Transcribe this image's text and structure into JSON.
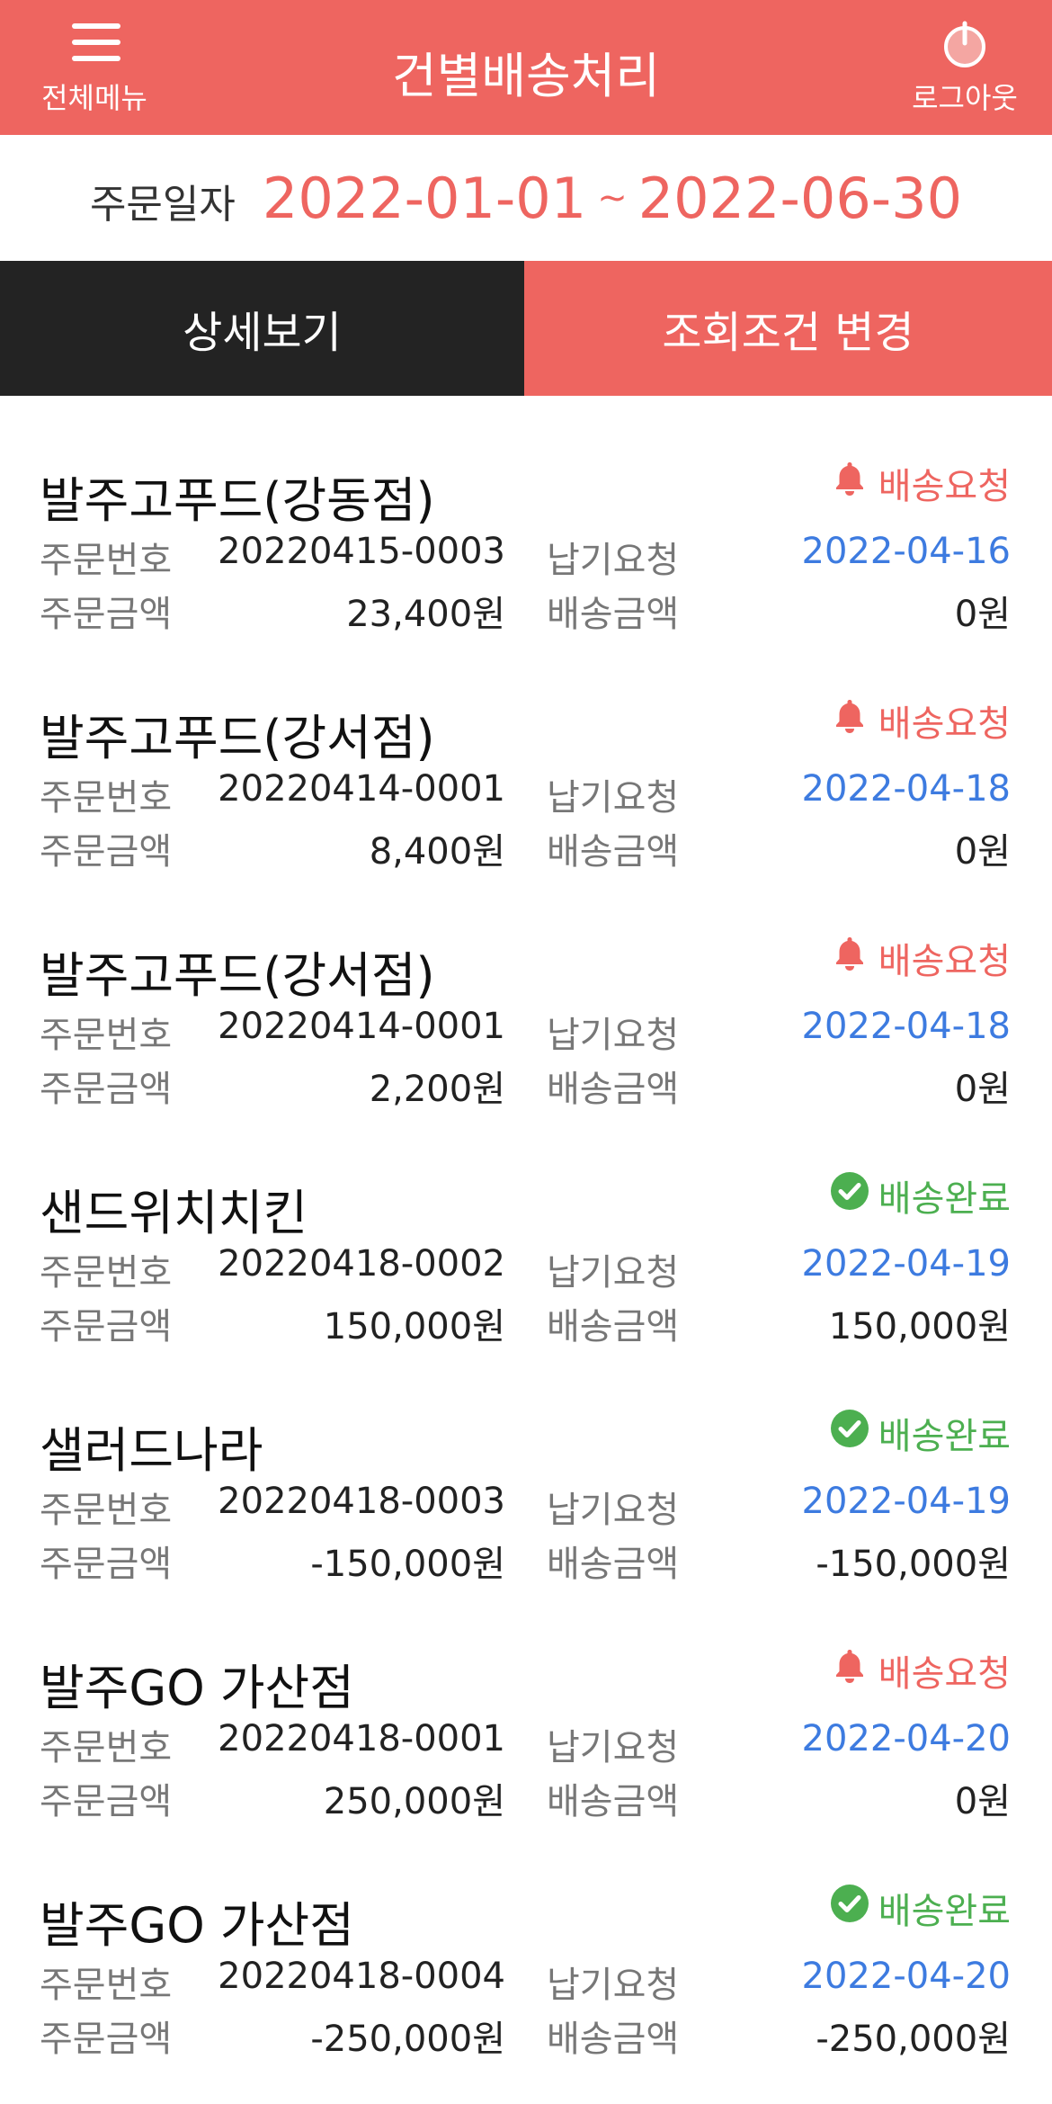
{
  "header": {
    "menu_label": "전체메뉴",
    "title": "건별배송처리",
    "logout_label": "로그아웃"
  },
  "date_range": {
    "label": "주문일자",
    "start": "2022-01-01",
    "separator": "~",
    "end": "2022-06-30"
  },
  "tabs": {
    "detail": "상세보기",
    "change_conditions": "조회조건 변경"
  },
  "labels": {
    "order_no": "주문번호",
    "due_request": "납기요청",
    "order_amount": "주문금액",
    "delivery_amount": "배송금액"
  },
  "colors": {
    "brand": "#EE6560",
    "dark_tab": "#232323",
    "date_blue": "#3D7BE0",
    "done_green": "#4CAF50"
  },
  "orders": [
    {
      "store": "발주고푸드(강동점)",
      "status": "배송요청",
      "status_icon": "bell-icon",
      "order_no": "20220415-0003",
      "due_date": "2022-04-16",
      "order_amount": "23,400원",
      "delivery_amount": "0원"
    },
    {
      "store": "발주고푸드(강서점)",
      "status": "배송요청",
      "status_icon": "bell-icon",
      "order_no": "20220414-0001",
      "due_date": "2022-04-18",
      "order_amount": "8,400원",
      "delivery_amount": "0원"
    },
    {
      "store": "발주고푸드(강서점)",
      "status": "배송요청",
      "status_icon": "bell-icon",
      "order_no": "20220414-0001",
      "due_date": "2022-04-18",
      "order_amount": "2,200원",
      "delivery_amount": "0원"
    },
    {
      "store": "샌드위치치킨",
      "status": "배송완료",
      "status_icon": "check-circle-icon",
      "order_no": "20220418-0002",
      "due_date": "2022-04-19",
      "order_amount": "150,000원",
      "delivery_amount": "150,000원"
    },
    {
      "store": "샐러드나라",
      "status": "배송완료",
      "status_icon": "check-circle-icon",
      "order_no": "20220418-0003",
      "due_date": "2022-04-19",
      "order_amount": "-150,000원",
      "delivery_amount": "-150,000원"
    },
    {
      "store": "발주GO 가산점",
      "status": "배송요청",
      "status_icon": "bell-icon",
      "order_no": "20220418-0001",
      "due_date": "2022-04-20",
      "order_amount": "250,000원",
      "delivery_amount": "0원"
    },
    {
      "store": "발주GO 가산점",
      "status": "배송완료",
      "status_icon": "check-circle-icon",
      "order_no": "20220418-0004",
      "due_date": "2022-04-20",
      "order_amount": "-250,000원",
      "delivery_amount": "-250,000원"
    }
  ]
}
